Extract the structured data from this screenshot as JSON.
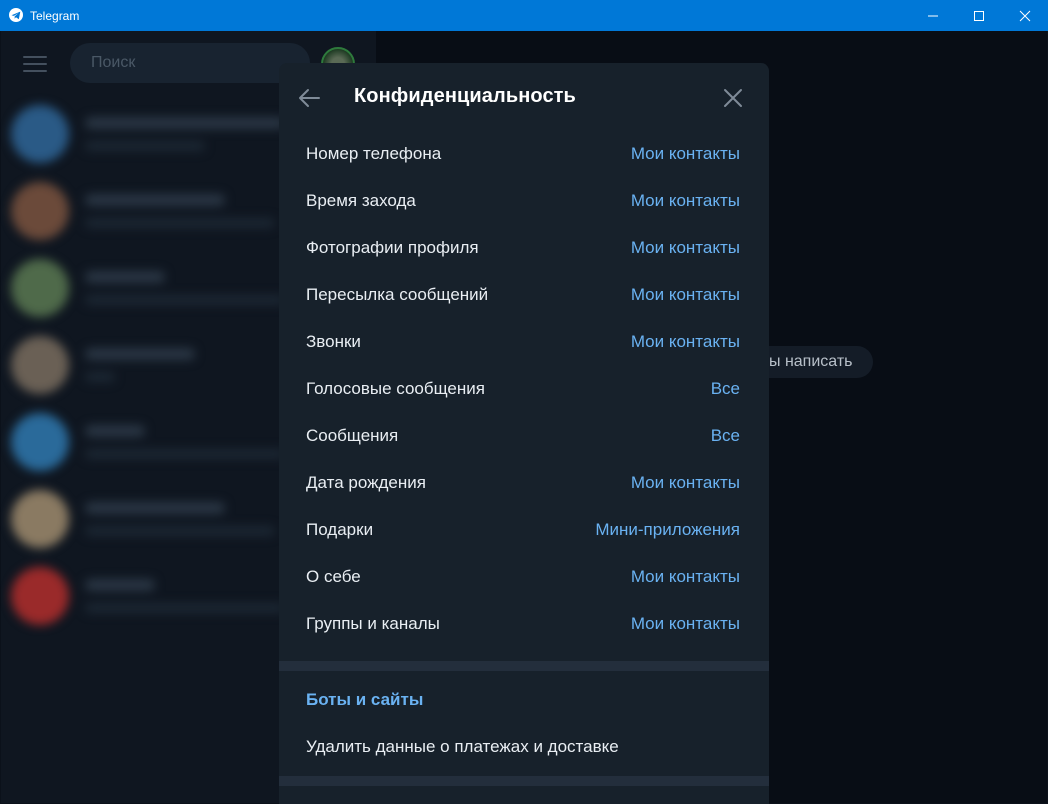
{
  "window": {
    "title": "Telegram"
  },
  "sidebar": {
    "search_placeholder": "Поиск"
  },
  "background": {
    "chip_text": "ы написать"
  },
  "modal": {
    "title": "Конфиденциальность",
    "rows": [
      {
        "label": "Номер телефона",
        "value": "Мои контакты"
      },
      {
        "label": "Время захода",
        "value": "Мои контакты"
      },
      {
        "label": "Фотографии профиля",
        "value": "Мои контакты"
      },
      {
        "label": "Пересылка сообщений",
        "value": "Мои контакты"
      },
      {
        "label": "Звонки",
        "value": "Мои контакты"
      },
      {
        "label": "Голосовые сообщения",
        "value": "Все"
      },
      {
        "label": "Сообщения",
        "value": "Все"
      },
      {
        "label": "Дата рождения",
        "value": "Мои контакты"
      },
      {
        "label": "Подарки",
        "value": "Мини-приложения"
      },
      {
        "label": "О себе",
        "value": "Мои контакты"
      },
      {
        "label": "Группы и каналы",
        "value": "Мои контакты"
      }
    ],
    "section_title": "Боты и сайты",
    "delete_payment_label": "Удалить данные о платежах и доставке"
  },
  "colors": {
    "accent": "#6ab2f2",
    "titlebar": "#0078d7",
    "modal_bg": "#17212b",
    "text": "#e9eef3"
  },
  "icons": {
    "back": "arrow-left-icon",
    "close": "close-icon",
    "menu": "hamburger-icon"
  }
}
